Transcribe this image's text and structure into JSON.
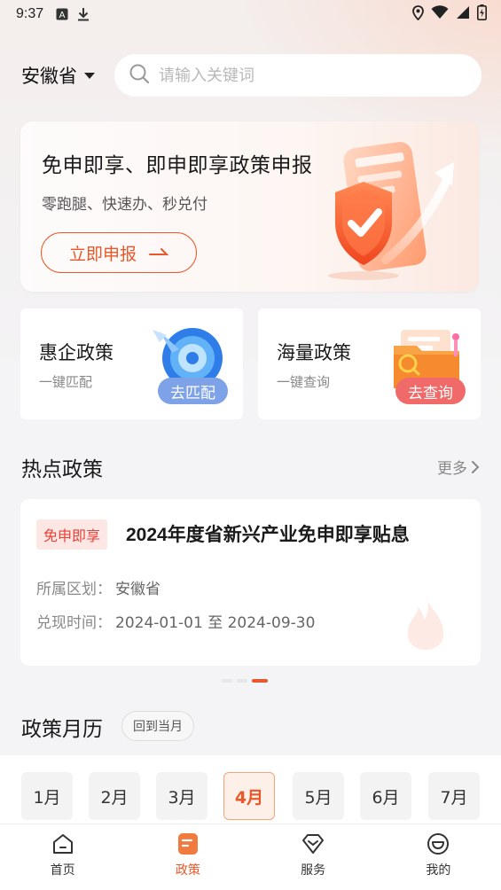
{
  "status_bar": {
    "time": "9:37"
  },
  "header": {
    "province": "安徽省",
    "search_placeholder": "请输入关键词"
  },
  "banner": {
    "title": "免申即享、即申即享政策申报",
    "subtitle": "零跑腿、快速办、秒兑付",
    "button_label": "立即申报"
  },
  "features": [
    {
      "title": "惠企政策",
      "subtitle": "一键匹配",
      "badge": "去匹配",
      "badge_color": "#7ea2e8"
    },
    {
      "title": "海量政策",
      "subtitle": "一键查询",
      "badge": "去查询",
      "badge_color": "#f06a6a"
    }
  ],
  "hot": {
    "title": "热点政策",
    "more": "更多",
    "card": {
      "tag": "免申即享",
      "title": "2024年度省新兴产业免申即享贴息",
      "region_label": "所属区划：",
      "region_value": "安徽省",
      "time_label": "兑现时间：",
      "time_value": "2024-01-01 至 2024-09-30"
    }
  },
  "calendar": {
    "title": "政策月历",
    "back_button": "回到当月",
    "months": [
      "1月",
      "2月",
      "3月",
      "4月",
      "5月",
      "6月",
      "7月"
    ],
    "active_month": "4月"
  },
  "tabbar": {
    "items": [
      {
        "label": "首页",
        "icon": "home-icon"
      },
      {
        "label": "政策",
        "icon": "policy-icon"
      },
      {
        "label": "服务",
        "icon": "diamond-icon"
      },
      {
        "label": "我的",
        "icon": "smile-icon"
      }
    ],
    "active": "政策"
  },
  "colors": {
    "accent": "#e8582a",
    "tag_bg": "#fde7e4",
    "tag_text": "#e64238"
  }
}
